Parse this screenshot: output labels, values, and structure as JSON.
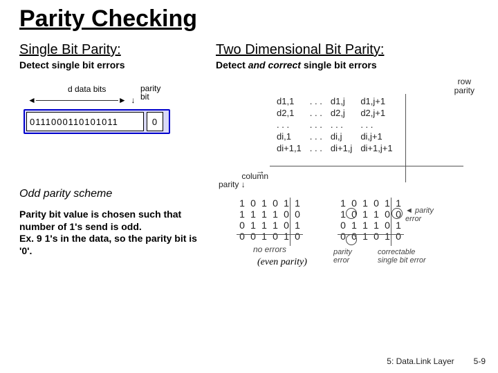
{
  "title": "Parity Checking",
  "left": {
    "heading": "Single Bit Parity:",
    "sub": "Detect single bit errors",
    "fig": {
      "d_data_bits_label": "d data bits",
      "parity_bit_label": "parity\nbit",
      "data_bits": "0111000110101011",
      "parity_bit": "0"
    },
    "odd_scheme_label": "Odd parity scheme",
    "note": "Parity bit value is chosen such that number of 1's send is odd.\nEx. 9 1's in the data, so the parity bit is '0'."
  },
  "right": {
    "heading": "Two Dimensional Bit Parity:",
    "sub_pre": "Detect ",
    "sub_em": "and correct",
    "sub_post": " single bit errors",
    "row_parity_label": "row\nparity",
    "col_parity_label": "column\nparity",
    "grid": {
      "r1": [
        "d1,1",
        ". . .",
        "d1,j",
        "d1,j+1"
      ],
      "r2": [
        "d2,1",
        ". . .",
        "d2,j",
        "d2,j+1"
      ],
      "r3": [
        ". . .",
        ". . .",
        ". . .",
        ". . ."
      ],
      "r4": [
        "di,1",
        ". . .",
        "di,j",
        "di,j+1"
      ],
      "r5": [
        "di+1,1",
        ". . .",
        "di+1,j",
        "di+1,j+1"
      ]
    },
    "matrix_left": {
      "rows": [
        [
          "1",
          "0",
          "1",
          "0",
          "1",
          "1"
        ],
        [
          "1",
          "1",
          "1",
          "1",
          "0",
          "0"
        ],
        [
          "0",
          "1",
          "1",
          "1",
          "0",
          "1"
        ],
        [
          "0",
          "0",
          "1",
          "0",
          "1",
          "0"
        ]
      ],
      "caption": "no errors"
    },
    "matrix_right": {
      "rows": [
        [
          "1",
          "0",
          "1",
          "0",
          "1",
          "1"
        ],
        [
          "1",
          "0",
          "1",
          "1",
          "0",
          "0"
        ],
        [
          "0",
          "1",
          "1",
          "1",
          "0",
          "1"
        ],
        [
          "0",
          "0",
          "1",
          "0",
          "1",
          "0"
        ]
      ],
      "parity_error_label": "parity\nerror",
      "caption_top": "parity\nerror",
      "caption_bottom": "correctable\nsingle bit error"
    },
    "even_parity_note": "(even parity)"
  },
  "footer": {
    "chapter": "5: Data.Link Layer",
    "page": "5-9"
  }
}
